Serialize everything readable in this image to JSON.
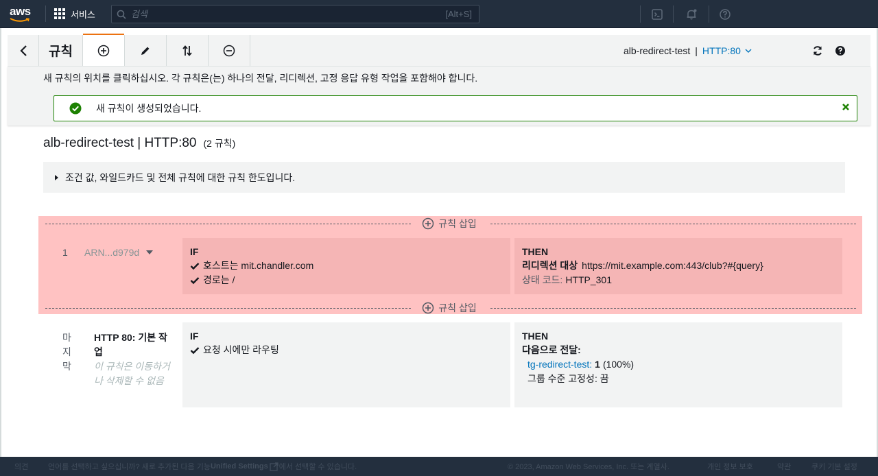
{
  "nav": {
    "logo": "aws",
    "services_label": "서비스",
    "search_placeholder": "검색",
    "search_shortcut": "[Alt+S]",
    "icons": [
      "cloudshell-icon",
      "bell-icon",
      "help-icon"
    ]
  },
  "toolbar": {
    "title": "규칙",
    "actions": [
      "add-icon",
      "edit-icon",
      "reorder-icon",
      "delete-icon"
    ],
    "load_balancer": "alb-redirect-test",
    "separator": "|",
    "listener": "HTTP:80",
    "accent_color": "#ec7211"
  },
  "info": {
    "instruction": "새 규칙의 위치를 클릭하십시오. 각 규칙은(는) 하나의 전달, 리디렉션, 고정 응답 유형 작업을 포함해야 합니다.",
    "flash_message": "새 규칙이 생성되었습니다.",
    "flash_color": "#1d8102"
  },
  "rules_header": {
    "title": "alb-redirect-test | HTTP:80",
    "count": "(2 규칙)",
    "expander_label": "조건 값, 와일드카드 및 전체 규칙에 대한 규칙 한도입니다."
  },
  "insert_label": "규칙 삽입",
  "rules": [
    {
      "number": "1",
      "arn": "ARN...d979d",
      "if_label": "IF",
      "conditions": [
        "호스트는 mit.chandler.com",
        "경로는 /"
      ],
      "then_label": "THEN",
      "action_title": "리디렉션 대상",
      "action_target": "https://mit.example.com:443/club?#{query}",
      "status_label": "상태 코드:",
      "status_value": "HTTP_301",
      "highlight_color": "#ffc2c2"
    }
  ],
  "default_rule": {
    "number_chars": [
      "마",
      "지",
      "막"
    ],
    "name": "HTTP 80: 기본 작업",
    "note": "이 규칙은 이동하거나 삭제할 수 없음",
    "if_label": "IF",
    "condition": "요청 시에만 라우팅",
    "then_label": "THEN",
    "action_title": "다음으로 전달:",
    "target_group": "tg-redirect-test",
    "weight": "1",
    "percent": "(100%)",
    "stickiness": "그룹 수준 고정성: 끔"
  },
  "footer": {
    "feedback": "의견",
    "lang_text_before": "언어를 선택하고 싶으십니까? 새로 추가된 다음 기능",
    "unified_settings": "Unified Settings",
    "lang_text_after": "에서 선택할 수 있습니다.",
    "copyright": "© 2023, Amazon Web Services, Inc. 또는 계열사.",
    "privacy": "개인 정보 보호",
    "terms": "약관",
    "cookies": "쿠키 기본 설정"
  }
}
